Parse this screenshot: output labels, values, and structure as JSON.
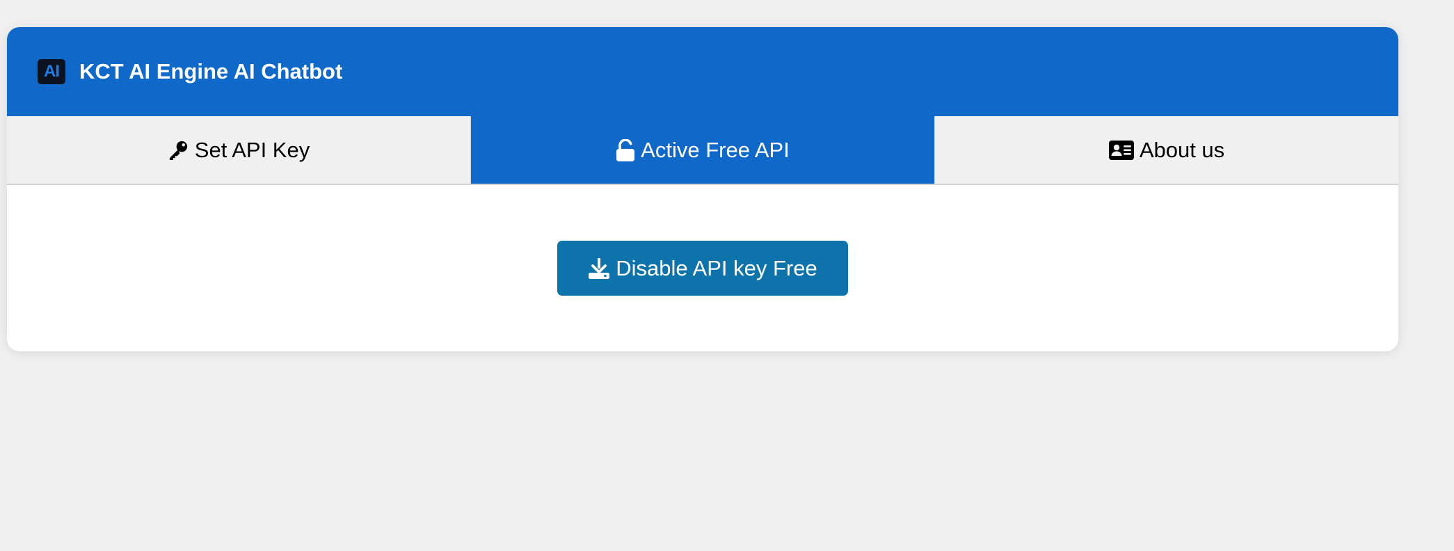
{
  "app": {
    "logo_text": "AI",
    "title": "KCT AI Engine AI Chatbot"
  },
  "tabs": [
    {
      "label": "Set API Key",
      "icon": "key-icon",
      "active": false
    },
    {
      "label": "Active Free API",
      "icon": "unlock-icon",
      "active": true
    },
    {
      "label": "About us",
      "icon": "id-card-icon",
      "active": false
    }
  ],
  "content": {
    "button_label": "Disable API key Free",
    "button_icon": "download-icon"
  },
  "colors": {
    "header": "#1068c9",
    "active_tab": "#1068c9",
    "button": "#0e73ab",
    "background": "#f0f0f0"
  }
}
